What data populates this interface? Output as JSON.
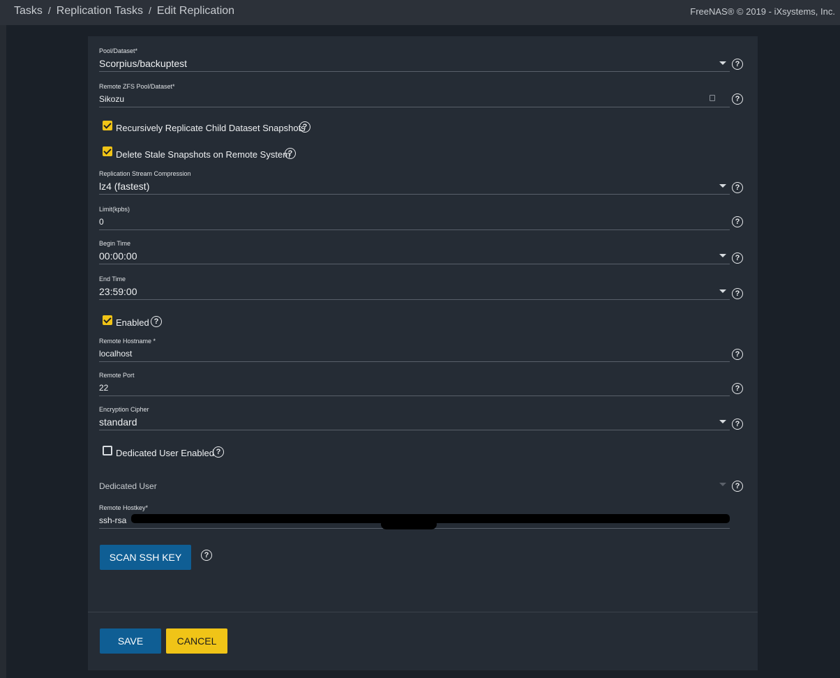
{
  "breadcrumb": {
    "items": [
      "Tasks",
      "Replication Tasks",
      "Edit Replication"
    ],
    "separator": "/"
  },
  "copyright": "FreeNAS® © 2019 - iXsystems, Inc.",
  "form": {
    "pool_dataset": {
      "label": "Pool/Dataset*",
      "value": "Scorpius/backuptest"
    },
    "remote_dataset": {
      "label": "Remote ZFS Pool/Dataset*",
      "value": "Sikozu"
    },
    "recursive": {
      "label": "Recursively Replicate Child Dataset Snapshots",
      "checked": true
    },
    "delete_stale": {
      "label": "Delete Stale Snapshots on Remote System",
      "checked": true
    },
    "compression": {
      "label": "Replication Stream Compression",
      "value": "lz4 (fastest)"
    },
    "limit": {
      "label": "Limit(kpbs)",
      "value": "0"
    },
    "begin_time": {
      "label": "Begin Time",
      "value": "00:00:00"
    },
    "end_time": {
      "label": "End Time",
      "value": "23:59:00"
    },
    "enabled": {
      "label": "Enabled",
      "checked": true
    },
    "remote_hostname": {
      "label": "Remote Hostname *",
      "value": "localhost"
    },
    "remote_port": {
      "label": "Remote Port",
      "value": "22"
    },
    "cipher": {
      "label": "Encryption Cipher",
      "value": "standard"
    },
    "dedicated_enabled": {
      "label": "Dedicated User Enabled",
      "checked": false
    },
    "dedicated_user": {
      "placeholder": "Dedicated User"
    },
    "hostkey": {
      "label": "Remote Hostkey*",
      "value": "ssh-rsa"
    }
  },
  "buttons": {
    "scan": "SCAN SSH KEY",
    "save": "SAVE",
    "cancel": "CANCEL"
  },
  "help_glyph": "?",
  "icons": {
    "dropdown": "caret-down-icon",
    "help": "help-circle-icon",
    "hostkey": "key-icon",
    "checkbox": "checkbox-icon"
  },
  "colors": {
    "accent_blue": "#0f5e94",
    "accent_yellow": "#f0c417",
    "card_bg": "#252c35",
    "page_bg": "#1a2028"
  }
}
